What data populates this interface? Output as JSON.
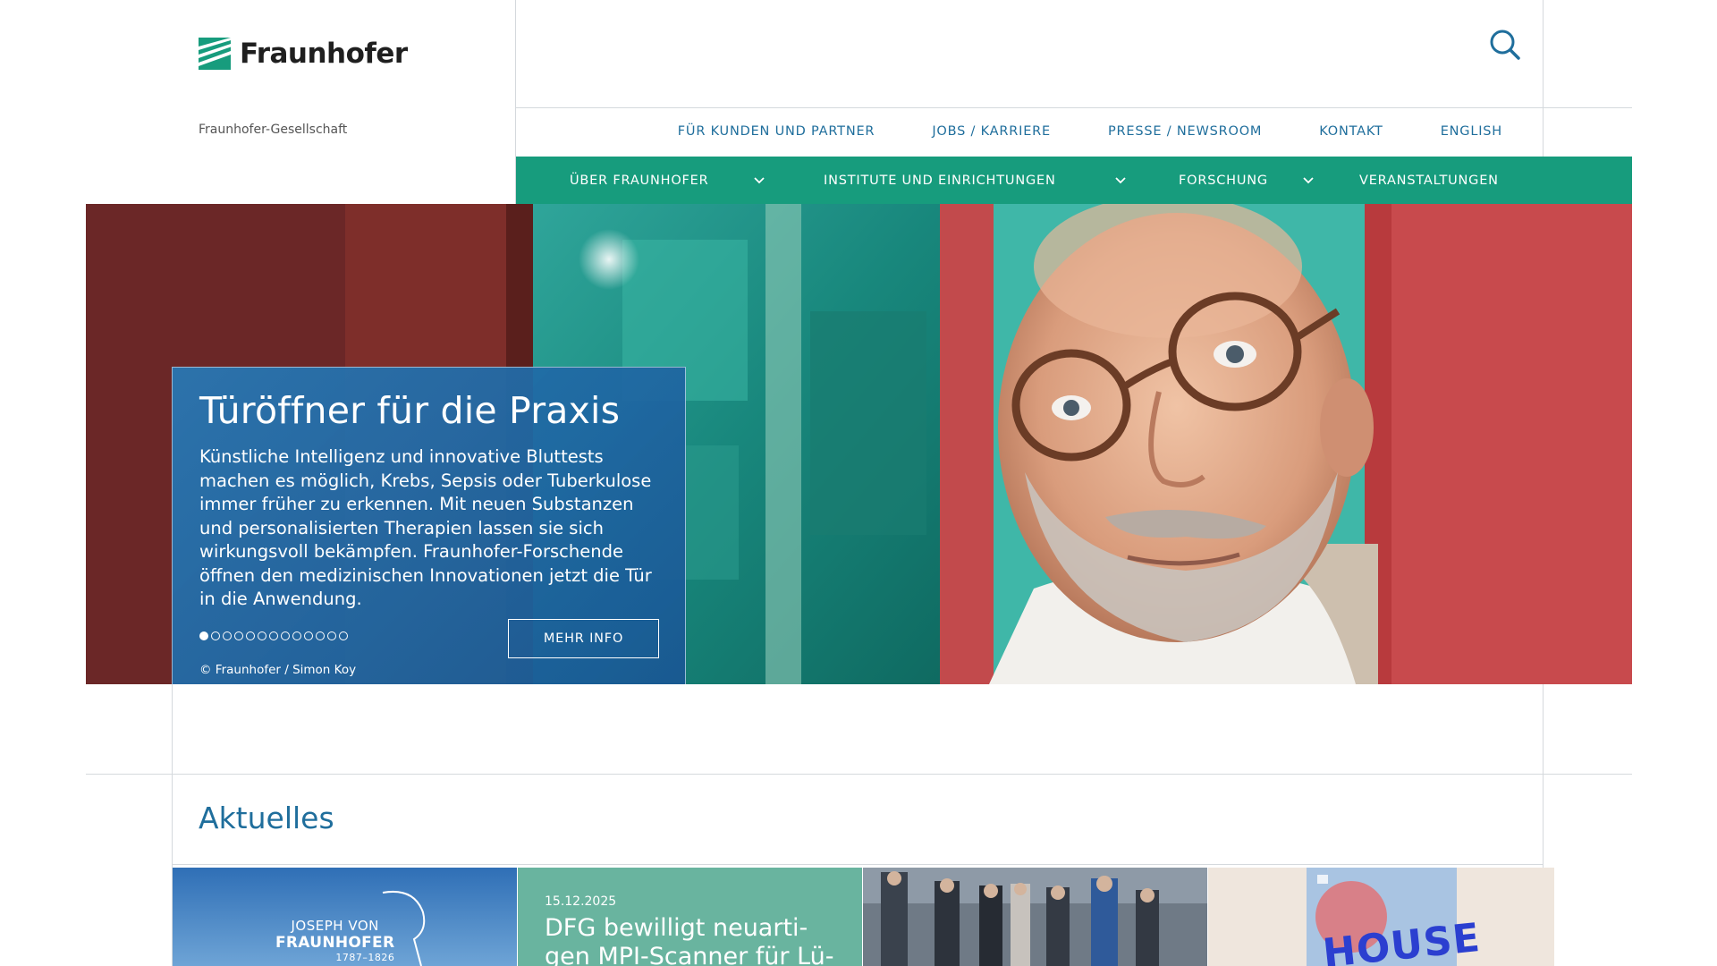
{
  "header": {
    "logo_text": "Fraunhofer",
    "org_name": "Fraunhofer-Gesellschaft",
    "search_label": "Suche"
  },
  "top_nav": {
    "items": [
      {
        "label": "FÜR KUNDEN UND PARTNER"
      },
      {
        "label": "JOBS / KARRIERE"
      },
      {
        "label": "PRESSE / NEWSROOM"
      },
      {
        "label": "KONTAKT"
      },
      {
        "label": "ENGLISH"
      }
    ]
  },
  "main_nav": {
    "items": [
      {
        "label": "ÜBER FRAUNHOFER",
        "has_dropdown": true
      },
      {
        "label": "INSTITUTE UND EINRICHTUNGEN",
        "has_dropdown": true
      },
      {
        "label": "FORSCHUNG",
        "has_dropdown": true
      },
      {
        "label": "VERANSTALTUNGEN",
        "has_dropdown": false
      }
    ]
  },
  "hero": {
    "title": "Türöffner für die Praxis",
    "text": "Künstliche Intelligenz und innovative Bluttests machen es möglich, Krebs, Sepsis oder Tuberkulose immer früher zu erkennen. Mit neuen Substanzen und personalisierten Therapien lassen sie sich wirkungsvoll bekämpfen. Fraunhofer-Forschende öffnen den medizinischen Innovationen jetzt die Tür in die Anwendung.",
    "button_label": "MEHR INFO",
    "credit": "© Fraunhofer / Simon Koy",
    "slides_total": 13,
    "active_slide": 1
  },
  "news": {
    "section_title": "Aktuelles",
    "tiles": [
      {
        "kind": "image",
        "line1": "JOSEPH VON",
        "line2": "FRAUNHOFER",
        "line3": "1787–1826"
      },
      {
        "kind": "text",
        "date": "15.12.2025",
        "headline": "DFG bewilligt neuarti-gen MPI-Scanner für Lü-"
      },
      {
        "kind": "image"
      },
      {
        "kind": "image",
        "poster_text": "HOUSE"
      }
    ]
  },
  "colors": {
    "brand_green": "#179c7d",
    "link_blue": "#1f6e9c",
    "hero_card_blue": "#2776b3",
    "tile_teal": "#69b49f"
  }
}
